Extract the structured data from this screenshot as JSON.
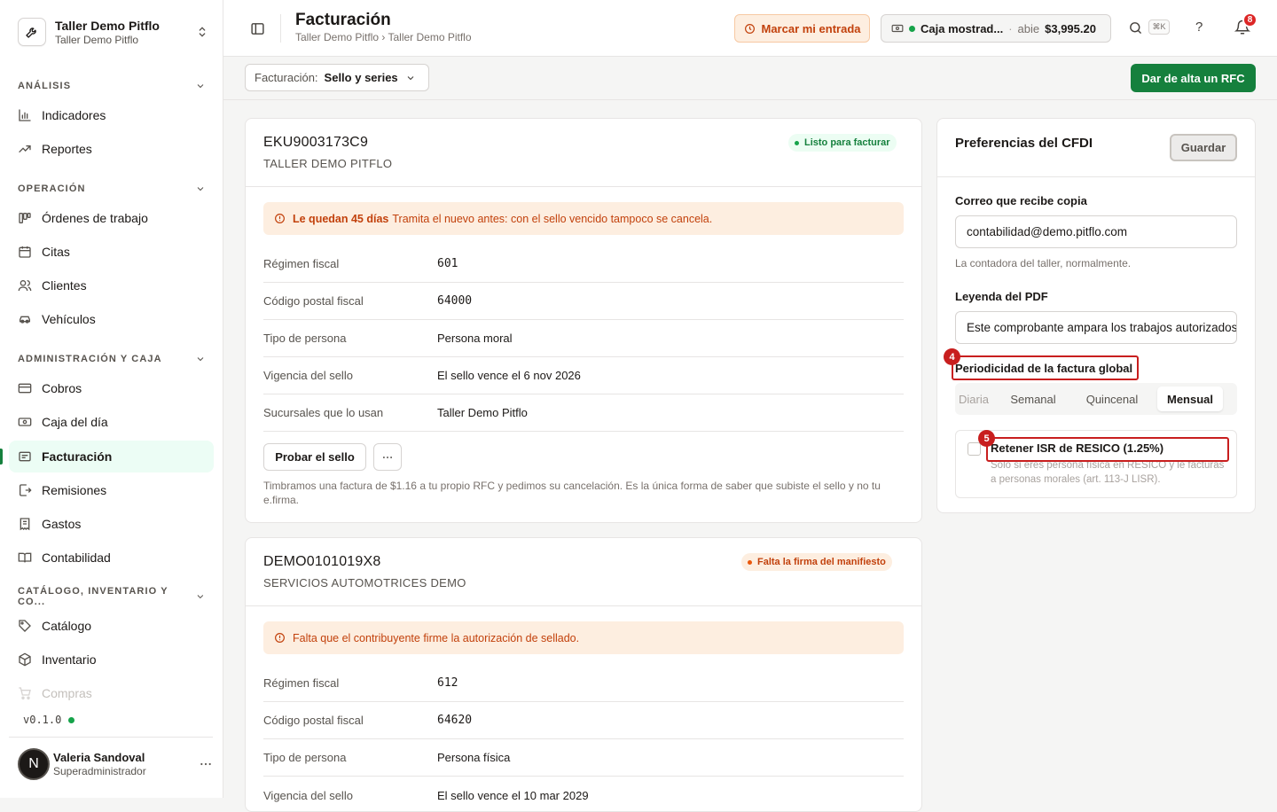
{
  "workspace": {
    "name": "Taller Demo Pitflo",
    "subtitle": "Taller Demo Pitflo"
  },
  "sidebar": {
    "sections": [
      {
        "label": "ANÁLISIS"
      },
      {
        "label": "OPERACIÓN"
      },
      {
        "label": "ADMINISTRACIÓN Y CAJA"
      },
      {
        "label": "CATÁLOGO, INVENTARIO Y CO..."
      }
    ],
    "items": [
      {
        "label": "Indicadores",
        "icon": "bar-chart-icon"
      },
      {
        "label": "Reportes",
        "icon": "trend-icon"
      },
      {
        "label": "Órdenes de trabajo",
        "icon": "kanban-icon"
      },
      {
        "label": "Citas",
        "icon": "calendar-icon"
      },
      {
        "label": "Clientes",
        "icon": "users-icon"
      },
      {
        "label": "Vehículos",
        "icon": "car-icon"
      },
      {
        "label": "Cobros",
        "icon": "card-icon"
      },
      {
        "label": "Caja del día",
        "icon": "cash-icon"
      },
      {
        "label": "Facturación",
        "icon": "invoice-icon",
        "active": true
      },
      {
        "label": "Remisiones",
        "icon": "file-export-icon"
      },
      {
        "label": "Gastos",
        "icon": "receipt-icon"
      },
      {
        "label": "Contabilidad",
        "icon": "book-icon"
      },
      {
        "label": "Catálogo",
        "icon": "tag-icon"
      },
      {
        "label": "Inventario",
        "icon": "box-icon"
      },
      {
        "label": "Compras",
        "icon": "cart-icon"
      }
    ],
    "version": "v0.1.0",
    "user": {
      "initial": "N",
      "name": "Valeria Sandoval",
      "role": "Superadministrador"
    }
  },
  "header": {
    "title": "Facturación",
    "breadcrumb": "Taller Demo Pitflo › Taller Demo Pitflo",
    "entry_button": "Marcar mi entrada",
    "cash": {
      "name": "Caja mostrad...",
      "sep": "·",
      "state": "abie",
      "amount": "$3,995.20"
    },
    "shortcut": "⌘K",
    "help": "?",
    "notifications": "8"
  },
  "toolbar": {
    "select_label": "Facturación:",
    "select_value": "Sello y series",
    "add_rfc_button": "Dar de alta un RFC"
  },
  "rfc_cards": [
    {
      "rfc": "EKU9003173C9",
      "name": "TALLER DEMO PITFLO",
      "status": "Listo para facturar",
      "alert_bold": "Le quedan 45 días",
      "alert_text": "Tramita el nuevo antes: con el sello vencido tampoco se cancela.",
      "rows": [
        {
          "k": "Régimen fiscal",
          "v": "601"
        },
        {
          "k": "Código postal fiscal",
          "v": "64000"
        },
        {
          "k": "Tipo de persona",
          "v": "Persona moral"
        },
        {
          "k": "Vigencia del sello",
          "v": "El sello vence el 6 nov 2026"
        },
        {
          "k": "Sucursales que lo usan",
          "v": "Taller Demo Pitflo"
        }
      ],
      "test_button": "Probar el sello",
      "help": "Timbramos una factura de $1.16 a tu propio RFC y pedimos su cancelación. Es la única forma de saber que subiste el sello y no tu e.firma."
    },
    {
      "rfc": "DEMO0101019X8",
      "name": "SERVICIOS AUTOMOTRICES DEMO",
      "status": "Falta la firma del manifiesto",
      "alert_text": "Falta que el contribuyente firme la autorización de sellado.",
      "rows": [
        {
          "k": "Régimen fiscal",
          "v": "612"
        },
        {
          "k": "Código postal fiscal",
          "v": "64620"
        },
        {
          "k": "Tipo de persona",
          "v": "Persona física"
        },
        {
          "k": "Vigencia del sello",
          "v": "El sello vence el 10 mar 2029"
        }
      ]
    }
  ],
  "preferences": {
    "title": "Preferencias del CFDI",
    "save_button": "Guardar",
    "email_label": "Correo que recibe copia",
    "email_value": "contabilidad@demo.pitflo.com",
    "email_help": "La contadora del taller, normalmente.",
    "legend_label": "Leyenda del PDF",
    "legend_value": "Este comprobante ampara los trabajos autorizados",
    "period_label": "Periodicidad de la factura global",
    "period_options": [
      "Diaria",
      "Semanal",
      "Quincenal",
      "Mensual"
    ],
    "period_selected": "Mensual",
    "resico_label": "Retener ISR de RESICO (1.25%)",
    "resico_help": "Solo si eres persona física en RESICO y le facturas a personas morales (art. 113-J LISR).",
    "markers": [
      "4",
      "5"
    ]
  },
  "colors": {
    "brand": "#15803d",
    "warning": "#c2410c",
    "highlight": "#c81e1e"
  }
}
